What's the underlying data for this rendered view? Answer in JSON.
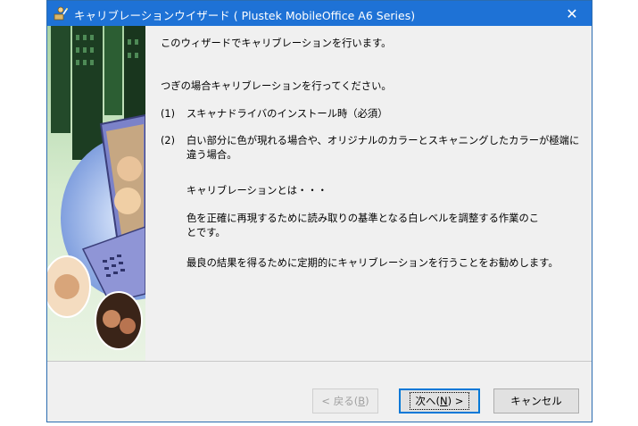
{
  "window": {
    "title": "キャリブレーションウイザード ( Plustek MobileOffice A6 Series)",
    "close_glyph": "✕"
  },
  "content": {
    "intro": "このウィザードでキャリブレーションを行います。",
    "when_heading": "つぎの場合キャリブレーションを行ってください。",
    "items": [
      {
        "num": "(1)",
        "line1": "スキャナドライバのインストール時（必須）",
        "line2": ""
      },
      {
        "num": "(2)",
        "line1": "白い部分に色が現れる場合や、オリジナルのカラーとスキャニングしたカラーが極端に",
        "line2": "違う場合。"
      }
    ],
    "what_heading": "キャリブレーションとは・・・",
    "what_line1": "色を正確に再現するために読み取りの基準となる白レベルを調整する作業のこ",
    "what_line2": "とです。",
    "recommend": "最良の結果を得るために定期的にキャリブレーションを行うことをお勧めします。"
  },
  "buttons": {
    "back": {
      "label": "< 戻る(",
      "key": "B",
      "tail": ")"
    },
    "next": {
      "label": "次へ(",
      "key": "N",
      "tail": ") >"
    },
    "cancel": {
      "label": "キャンセル"
    }
  },
  "colors": {
    "titlebar": "#1e72d6",
    "default_button_border": "#0078d7"
  }
}
